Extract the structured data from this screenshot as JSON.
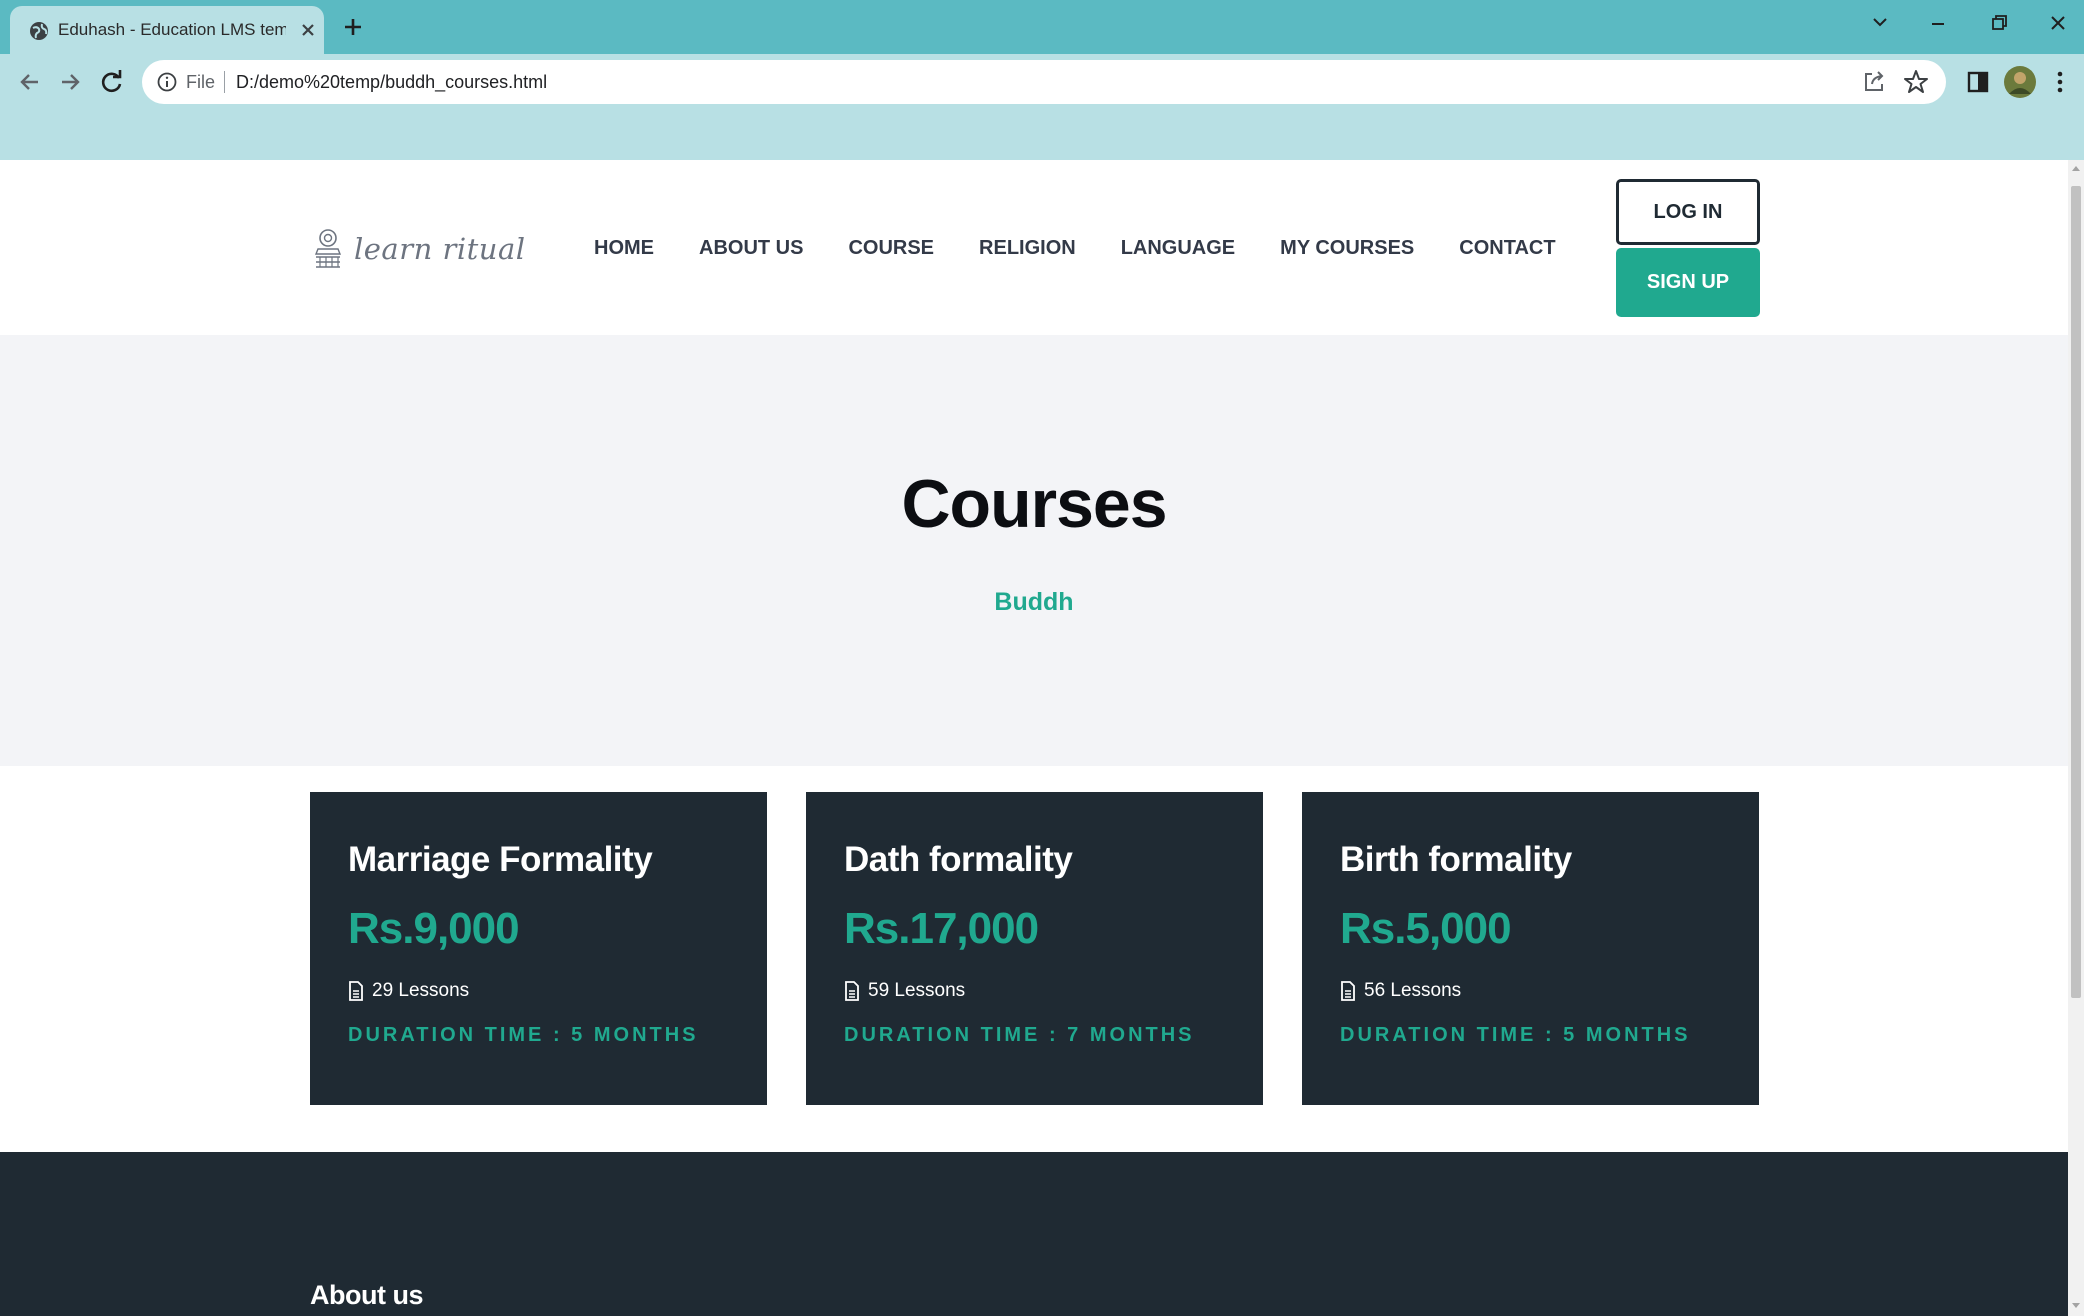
{
  "browser": {
    "tab_title": "Eduhash - Education LMS templa",
    "url_scheme": "File",
    "url": "D:/demo%20temp/buddh_courses.html"
  },
  "header": {
    "logo_text": "learn ritual",
    "nav": [
      "HOME",
      "ABOUT US",
      "COURSE",
      "RELIGION",
      "LANGUAGE",
      "MY COURSES",
      "CONTACT"
    ],
    "login_label": "LOG IN",
    "signup_label": "SIGN UP"
  },
  "banner": {
    "title": "Courses",
    "subtitle": "Buddh"
  },
  "courses": [
    {
      "title": "Marriage Formality",
      "price": "Rs.9,000",
      "lessons": "29 Lessons",
      "duration": "DURATION TIME : 5 MONTHS"
    },
    {
      "title": "Dath formality",
      "price": "Rs.17,000",
      "lessons": "59 Lessons",
      "duration": "DURATION TIME : 7 MONTHS"
    },
    {
      "title": "Birth formality",
      "price": "Rs.5,000",
      "lessons": "56 Lessons",
      "duration": "DURATION TIME : 5 MONTHS"
    }
  ],
  "footer": {
    "about_heading": "About us"
  },
  "colors": {
    "accent": "#20a98f",
    "dark": "#1f2a33",
    "banner_bg": "#f3f4f7",
    "chrome_tab_strip": "#5bbac2",
    "chrome_toolbar": "#b8e0e4"
  }
}
